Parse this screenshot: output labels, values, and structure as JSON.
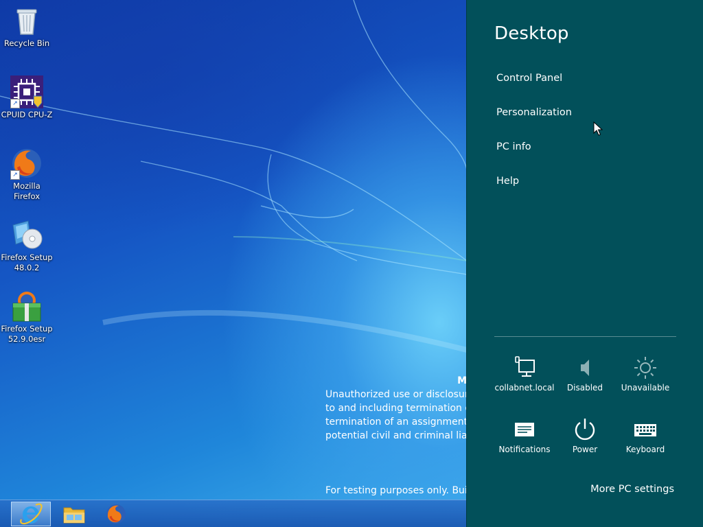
{
  "desktop": {
    "icons": [
      {
        "label": "Recycle Bin",
        "icon": "recycle-bin-icon"
      },
      {
        "label": "CPUID CPU-Z",
        "icon": "cpuz-icon"
      },
      {
        "label": "Mozilla\nFirefox",
        "icon": "firefox-icon"
      },
      {
        "label": "Firefox Setup\n48.0.2",
        "icon": "installer-disc-icon"
      },
      {
        "label": "Firefox Setup\n52.9.0esr",
        "icon": "installer-box-icon"
      }
    ],
    "notice": {
      "heading": "M",
      "lines": [
        "Unauthorized use or disclosure",
        "to and including termination o",
        "termination of an assignment c",
        "potential civil and criminal liab"
      ],
      "build_note": "For testing purposes only. Build"
    }
  },
  "taskbar": {
    "buttons": [
      {
        "icon": "internet-explorer-icon",
        "active": true
      },
      {
        "icon": "file-explorer-icon",
        "active": false
      },
      {
        "icon": "firefox-icon",
        "active": false
      }
    ]
  },
  "charm": {
    "title": "Desktop",
    "links": [
      "Control Panel",
      "Personalization",
      "PC info",
      "Help"
    ],
    "tiles": [
      {
        "label": "collabnet.local",
        "icon": "network-icon"
      },
      {
        "label": "Disabled",
        "icon": "speaker-icon"
      },
      {
        "label": "Unavailable",
        "icon": "brightness-icon"
      },
      {
        "label": "Notifications",
        "icon": "notifications-icon"
      },
      {
        "label": "Power",
        "icon": "power-icon"
      },
      {
        "label": "Keyboard",
        "icon": "keyboard-icon"
      }
    ],
    "more_settings": "More PC settings"
  },
  "colors": {
    "charm_bg": "#02505a",
    "wallpaper_blue": "#1556c4"
  }
}
